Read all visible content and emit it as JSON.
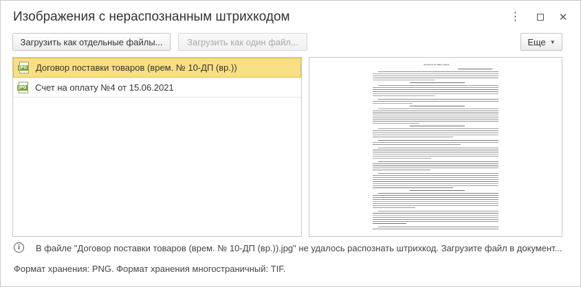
{
  "window": {
    "title": "Изображения с нераспознанным штрихкодом",
    "controls": {
      "more": "⋮",
      "maximize": "maximize",
      "close": "✕"
    }
  },
  "toolbar": {
    "upload_separate": "Загрузить как отдельные файлы...",
    "upload_single": "Загрузить как один файл...",
    "more": "Еще"
  },
  "files": [
    {
      "name": "Договор поставки товаров (врем. № 10-ДП (вр.))",
      "icon": "jpg-file-icon",
      "icon_label": "JPG",
      "selected": true
    },
    {
      "name": "Счет на оплату №4 от 15.06.2021",
      "icon": "jpg-file-icon",
      "icon_label": "JPG",
      "selected": false
    }
  ],
  "preview": {
    "doc_title": "Договор\nна поставку товаров"
  },
  "info": {
    "icon": "info-icon",
    "message": "В файле \"Договор поставки товаров (врем. № 10-ДП (вр.)).jpg\" не удалось распознать штрихкод. Загрузите файл в документ...",
    "formats": "Формат хранения: PNG. Формат хранения многостраничный: TIF."
  },
  "colors": {
    "selected_bg": "#f9df84",
    "selected_border": "#e0bd3b",
    "jpg_icon": "#7fa23c"
  }
}
